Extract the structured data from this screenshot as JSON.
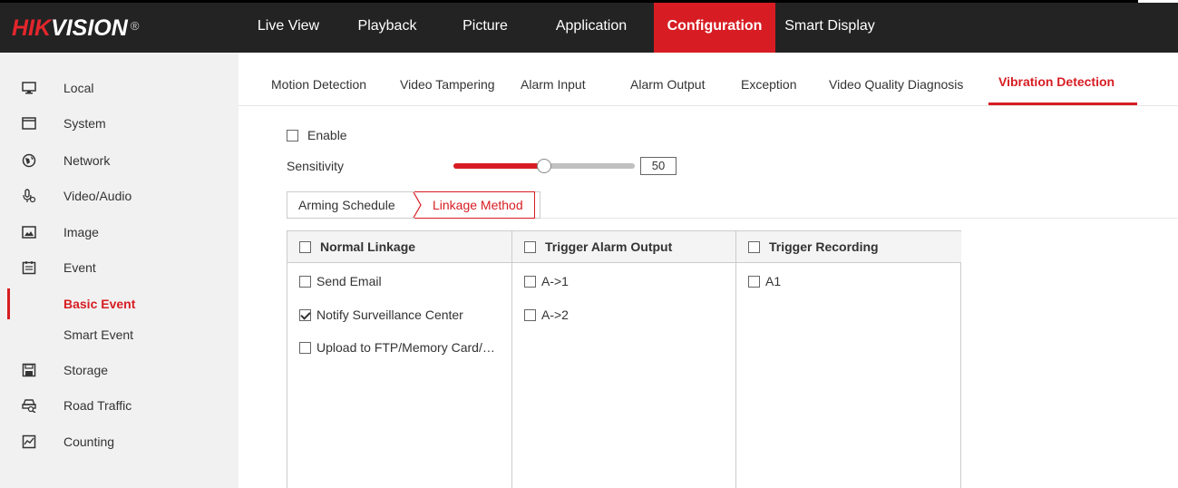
{
  "brand": {
    "primary": "HIK",
    "secondary": "VISION",
    "reg": "®"
  },
  "colors": {
    "accent": "#d71d23",
    "header_bg": "#232323",
    "sidebar_bg": "#f1f1f1"
  },
  "nav": [
    {
      "label": "Live View"
    },
    {
      "label": "Playback"
    },
    {
      "label": "Picture"
    },
    {
      "label": "Application"
    },
    {
      "label": "Configuration",
      "active": true
    },
    {
      "label": "Smart Display"
    }
  ],
  "sidebar": {
    "items": [
      {
        "label": "Local",
        "icon": "monitor-icon"
      },
      {
        "label": "System",
        "icon": "window-icon"
      },
      {
        "label": "Network",
        "icon": "globe-icon"
      },
      {
        "label": "Video/Audio",
        "icon": "microphone-icon"
      },
      {
        "label": "Image",
        "icon": "image-icon"
      },
      {
        "label": "Event",
        "icon": "calendar-icon"
      },
      {
        "label": "Basic Event",
        "sub": true,
        "active": true
      },
      {
        "label": "Smart Event",
        "sub": true
      },
      {
        "label": "Storage",
        "icon": "floppy-icon"
      },
      {
        "label": "Road Traffic",
        "icon": "road-traffic-icon"
      },
      {
        "label": "Counting",
        "icon": "chart-icon"
      }
    ]
  },
  "tabs": [
    {
      "label": "Motion Detection"
    },
    {
      "label": "Video Tampering"
    },
    {
      "label": "Alarm Input"
    },
    {
      "label": "Alarm Output"
    },
    {
      "label": "Exception"
    },
    {
      "label": "Video Quality Diagnosis"
    },
    {
      "label": "Vibration Detection",
      "active": true
    }
  ],
  "settings": {
    "enable_label": "Enable",
    "enable_checked": false,
    "sensitivity_label": "Sensitivity",
    "sensitivity_value": "50",
    "sensitivity_fraction": 0.5
  },
  "subtabs": [
    {
      "label": "Arming Schedule"
    },
    {
      "label": "Linkage Method",
      "active": true
    }
  ],
  "linkage": {
    "columns": [
      {
        "header": "Normal Linkage",
        "items": [
          {
            "label": "Send Email",
            "checked": false
          },
          {
            "label": "Notify Surveillance Center",
            "checked": true
          },
          {
            "label": "Upload to FTP/Memory Card/…",
            "checked": false
          }
        ]
      },
      {
        "header": "Trigger Alarm Output",
        "items": [
          {
            "label": "A->1",
            "checked": false
          },
          {
            "label": "A->2",
            "checked": false
          }
        ]
      },
      {
        "header": "Trigger Recording",
        "items": [
          {
            "label": "A1",
            "checked": false
          }
        ]
      }
    ]
  }
}
